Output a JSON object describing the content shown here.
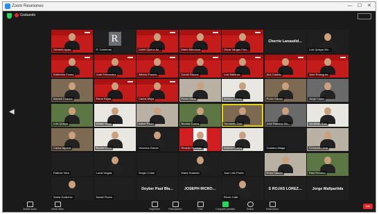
{
  "window": {
    "title": "Zoom Reuniones",
    "controls": [
      "—",
      "☐",
      "✕"
    ]
  },
  "topbar": {
    "recording_label": "Grabando"
  },
  "colors": {
    "accent": "#c41b1b",
    "zoom_green": "#23d959",
    "recording_red": "#e02828",
    "active_speaker": "#e5d414"
  },
  "participants": [
    {
      "name": "Gerardo Ayala",
      "style": "red"
    },
    {
      "name": "R. Cardenas",
      "style": "dark",
      "avatar_letter": "R"
    },
    {
      "name": "Lizeth Quiroz Az...",
      "style": "red"
    },
    {
      "name": "Mario Mendoza",
      "style": "red"
    },
    {
      "name": "Oscar Vargas Pinz...",
      "style": "red"
    },
    {
      "name": "Cherrie Lanasdid...",
      "style": "dark",
      "name_only": true
    },
    {
      "name": "Luis Quispe Mo...",
      "style": "dark"
    },
    {
      "name": "Katherine Flores",
      "style": "red"
    },
    {
      "name": "Juan Fernandez",
      "style": "red"
    },
    {
      "name": "Alfredo Parado",
      "style": "red"
    },
    {
      "name": "Daniel Ramos",
      "style": "red"
    },
    {
      "name": "Luis Martinez",
      "style": "red"
    },
    {
      "name": "Ana Castillo",
      "style": "red"
    },
    {
      "name": "Jose Rodriguez",
      "style": "red"
    },
    {
      "name": "Marisol Chavez",
      "style": "photo-room"
    },
    {
      "name": "Elena Rojas",
      "style": "red"
    },
    {
      "name": "Carlos Mejia",
      "style": "red"
    },
    {
      "name": "Pedro Salas",
      "style": "photo-light"
    },
    {
      "name": "Melissa Torres",
      "style": "photo-white"
    },
    {
      "name": "Rocio Garcia",
      "style": "photo-room"
    },
    {
      "name": "Jorge Lopez",
      "style": "photo-gray"
    },
    {
      "name": "Luis Quispe",
      "style": "photo-green"
    },
    {
      "name": "Miriam Vega",
      "style": "photo-white"
    },
    {
      "name": "Isabel Perez",
      "style": "photo-light"
    },
    {
      "name": "Nicolas Cueva",
      "style": "photo-green"
    },
    {
      "name": "Hernando Diaz",
      "style": "photo-room",
      "active": true
    },
    {
      "name": "Jose Ramirez Mo...",
      "style": "photo-gray"
    },
    {
      "name": "Jonathan Ruiz",
      "style": "photo-white"
    },
    {
      "name": "Carlos Aguirre",
      "style": "photo-room"
    },
    {
      "name": "Beatriz Leon",
      "style": "photo-white"
    },
    {
      "name": "Veronica Garcia",
      "style": "dark"
    },
    {
      "name": "Ricardo Huaman",
      "style": "flag"
    },
    {
      "name": "Antonio Cueva",
      "style": "photo-white"
    },
    {
      "name": "Gustavo Aliaga",
      "style": "dark"
    },
    {
      "name": "Fernando Lima",
      "style": "photo-light"
    },
    {
      "name": "Patricia Vera",
      "style": "dark"
    },
    {
      "name": "Lucia Vargas",
      "style": "dark"
    },
    {
      "name": "Sergio Colan",
      "style": "dark"
    },
    {
      "name": "Maria Huaman",
      "style": "dark"
    },
    {
      "name": "Jose Luis Prado",
      "style": "dark"
    },
    {
      "name": "Rosa Castillo",
      "style": "photo-light"
    },
    {
      "name": "Raul Romero",
      "style": "photo-green"
    },
    {
      "name": "Sonia Gutierrez",
      "style": "dark"
    },
    {
      "name": "Daniel Flores",
      "style": "dark"
    },
    {
      "name": "Deyber Paul Bla...",
      "style": "dark",
      "name_only": true
    },
    {
      "name": "JOSEPH IRCRO...",
      "style": "dark",
      "name_only": true
    },
    {
      "name": "Elmer Calle",
      "style": "dark"
    },
    {
      "name": "S ROJAS LOREZ...",
      "style": "dark",
      "name_only": true
    },
    {
      "name": "Jorge Mallpartida",
      "style": "dark",
      "name_only": true
    }
  ],
  "toolbar": {
    "items": [
      {
        "label": "Activar audio",
        "icon": "mic-icon"
      },
      {
        "label": "Iniciar video",
        "icon": "video-icon"
      },
      {
        "label": "Seguridad",
        "icon": "shield-icon"
      },
      {
        "label": "Participantes",
        "icon": "participants-icon"
      },
      {
        "label": "Chat",
        "icon": "chat-icon"
      },
      {
        "label": "Compartir pantalla",
        "icon": "share-screen-icon",
        "green": true
      },
      {
        "label": "Grabar",
        "icon": "record-icon"
      },
      {
        "label": "Reacciones",
        "icon": "reactions-icon"
      }
    ],
    "end_label": "Salir"
  }
}
